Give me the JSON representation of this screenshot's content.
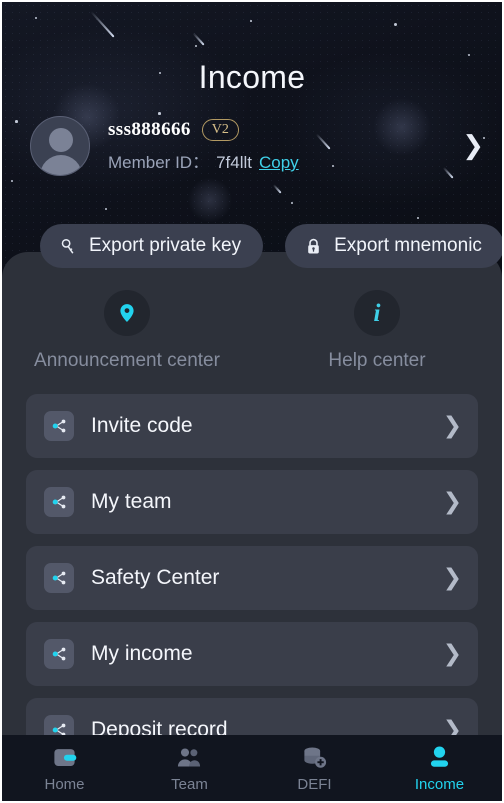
{
  "header": {
    "title": "Income"
  },
  "profile": {
    "avatar_icon": "user-avatar-icon",
    "username": "sss888666",
    "level_badge": "V2",
    "member_id_label": "Member ID：",
    "member_id_value": "7f4llt",
    "copy_label": "Copy",
    "chevron_icon": "chevron-right-icon"
  },
  "export_buttons": [
    {
      "label": "Export private key",
      "icon": "key-icon"
    },
    {
      "label": "Export mnemonic",
      "icon": "lock-icon"
    }
  ],
  "shortcuts": [
    {
      "label": "Announcement center",
      "icon": "location-pin-icon"
    },
    {
      "label": "Help center",
      "icon": "info-icon"
    }
  ],
  "menu_items": [
    {
      "label": "Invite code",
      "icon": "share-network-icon",
      "chevron": "chevron-right-icon"
    },
    {
      "label": "My team",
      "icon": "share-network-icon",
      "chevron": "chevron-right-icon"
    },
    {
      "label": "Safety Center",
      "icon": "share-network-icon",
      "chevron": "chevron-right-icon"
    },
    {
      "label": "My income",
      "icon": "share-network-icon",
      "chevron": "chevron-right-icon"
    },
    {
      "label": "Deposit record",
      "icon": "share-network-icon",
      "chevron": "chevron-right-icon"
    }
  ],
  "bottom_nav": [
    {
      "label": "Home",
      "icon": "wallet-icon",
      "active": false
    },
    {
      "label": "Team",
      "icon": "people-icon",
      "active": false
    },
    {
      "label": "DEFI",
      "icon": "coins-plus-icon",
      "active": false
    },
    {
      "label": "Income",
      "icon": "person-icon",
      "active": true
    }
  ],
  "colors": {
    "accent_cyan": "#22d3ee",
    "link_cyan": "#3fd0e8",
    "badge_gold": "#d8c08a",
    "panel_bg": "#2d313a",
    "card_bg": "#3a3e4a",
    "nav_bg": "#11151f",
    "hero_bg": "#0d1018"
  }
}
